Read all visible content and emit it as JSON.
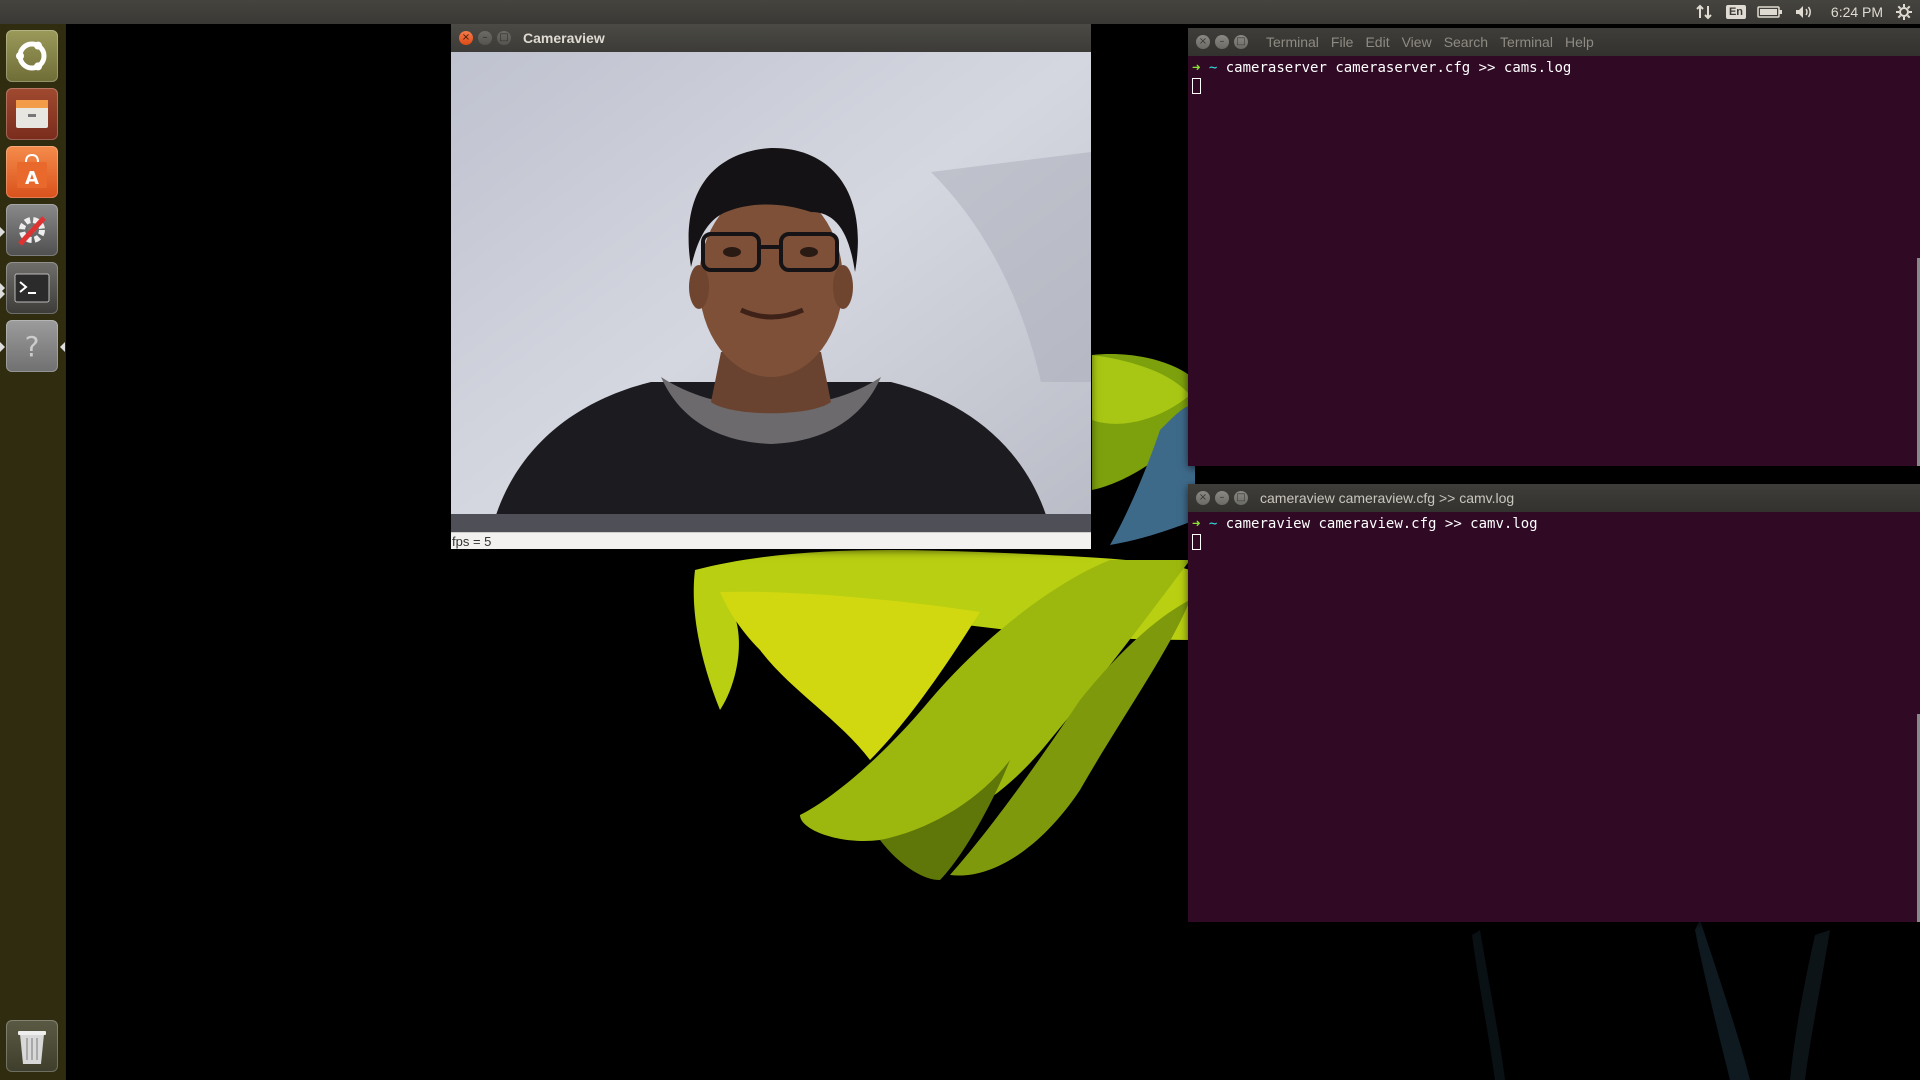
{
  "top_panel": {
    "language": "En",
    "clock": "6:24 PM",
    "indicators": [
      "network-updown-icon",
      "battery-icon",
      "volume-icon",
      "gear-icon"
    ]
  },
  "launcher": {
    "items": [
      "ubuntu-dash-icon",
      "files-icon",
      "software-center-icon",
      "system-settings-icon",
      "terminal-icon",
      "help-icon",
      "trash-icon"
    ]
  },
  "camera_window": {
    "title": "Cameraview",
    "status": "fps = 5"
  },
  "terminal_1": {
    "menu": [
      "Terminal",
      "File",
      "Edit",
      "View",
      "Search",
      "Terminal",
      "Help"
    ],
    "prompt_arrow": "➜",
    "prompt_dir": "~",
    "command": "cameraserver cameraserver.cfg >> cams.log"
  },
  "terminal_2": {
    "title": "cameraview cameraview.cfg >> camv.log",
    "prompt_arrow": "➜",
    "prompt_dir": "~",
    "command": "cameraview cameraview.cfg >> camv.log"
  },
  "colors": {
    "terminal_bg": "#300a24",
    "launcher_bg": "#343010",
    "close_button": "#df4b16"
  }
}
